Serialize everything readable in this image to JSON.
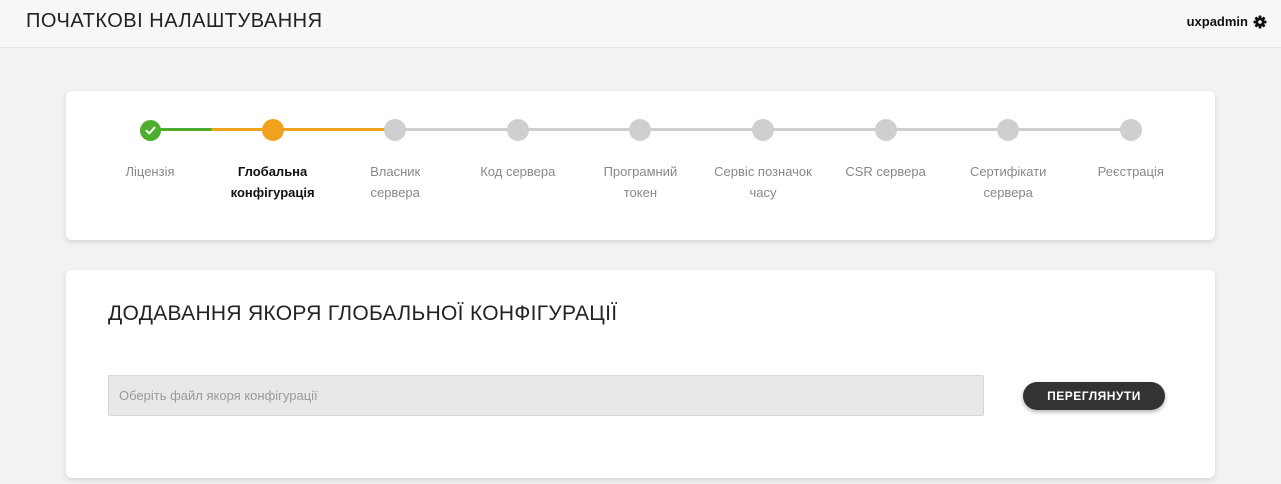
{
  "header": {
    "title": "ПОЧАТКОВІ НАЛАШТУВАННЯ",
    "username": "uxpadmin",
    "user_icon": "gear-icon"
  },
  "stepper": {
    "colors": {
      "done": "#4cae2c",
      "active": "#f0a21d",
      "pending": "#cfcfcf"
    },
    "steps": [
      {
        "line1": "Ліцензія",
        "line2": "",
        "status": "done"
      },
      {
        "line1": "Глобальна",
        "line2": "конфігурація",
        "status": "active"
      },
      {
        "line1": "Власник",
        "line2": "сервера",
        "status": "pending"
      },
      {
        "line1": "Код сервера",
        "line2": "",
        "status": "pending"
      },
      {
        "line1": "Програмний",
        "line2": "токен",
        "status": "pending"
      },
      {
        "line1": "Сервіс позначок",
        "line2": "часу",
        "status": "pending"
      },
      {
        "line1": "CSR сервера",
        "line2": "",
        "status": "pending"
      },
      {
        "line1": "Сертифікати",
        "line2": "сервера",
        "status": "pending"
      },
      {
        "line1": "Реєстрація",
        "line2": "",
        "status": "pending"
      }
    ]
  },
  "form": {
    "title": "ДОДАВАННЯ ЯКОРЯ ГЛОБАЛЬНОЇ КОНФІГУРАЦІЇ",
    "file_placeholder": "Оберіть файл якоря конфігурації",
    "browse_label": "ПЕРЕГЛЯНУТИ"
  }
}
